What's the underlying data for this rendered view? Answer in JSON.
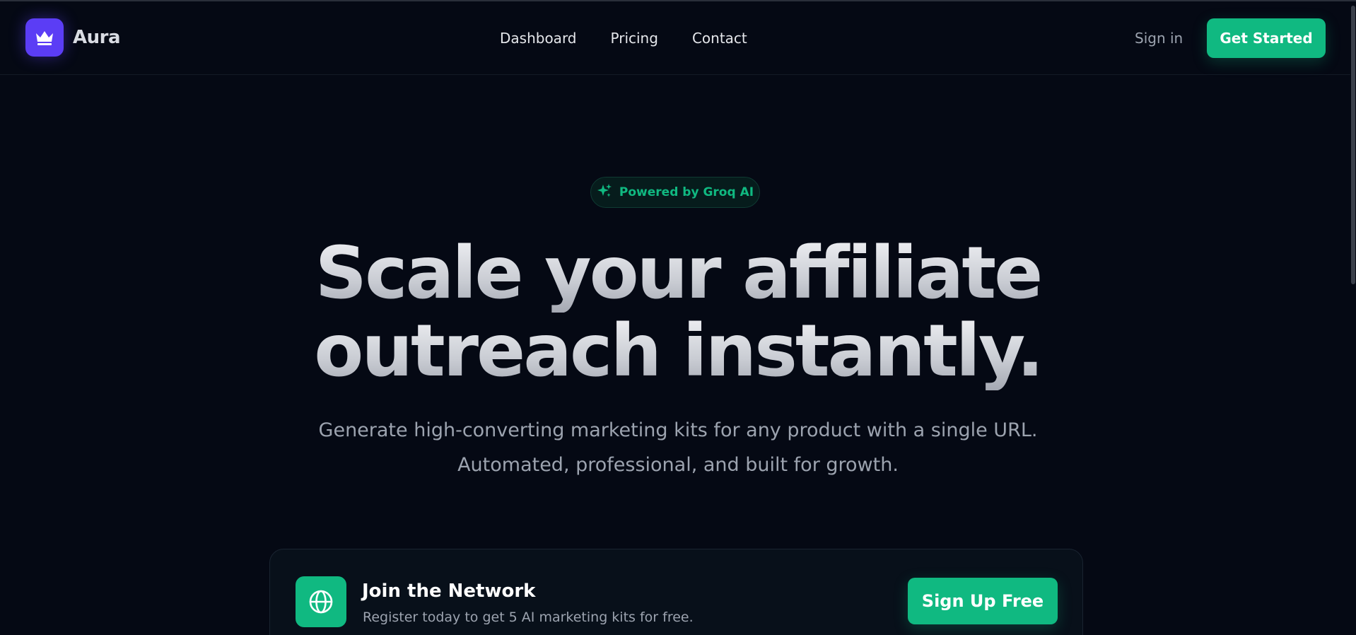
{
  "brand": {
    "name": "Aura",
    "logo_icon": "crown-icon",
    "accent": "#5b3df5"
  },
  "nav": {
    "links": [
      {
        "label": "Dashboard"
      },
      {
        "label": "Pricing"
      },
      {
        "label": "Contact"
      }
    ],
    "sign_in": "Sign in",
    "cta": "Get Started"
  },
  "hero": {
    "badge": {
      "label": "Powered by Groq AI",
      "icon": "sparkles-icon"
    },
    "headline_line1": "Scale your affiliate",
    "headline_line2": "outreach instantly.",
    "subtitle_line1": "Generate high-converting marketing kits for any product with a single URL.",
    "subtitle_line2": "Automated, professional, and built for growth."
  },
  "card": {
    "icon": "globe-icon",
    "title": "Join the Network",
    "description": "Register today to get 5 AI marketing kits for free.",
    "button": "Sign Up Free"
  },
  "colors": {
    "background": "#050914",
    "primary_green": "#10b981",
    "text_muted": "#9ca3af"
  }
}
